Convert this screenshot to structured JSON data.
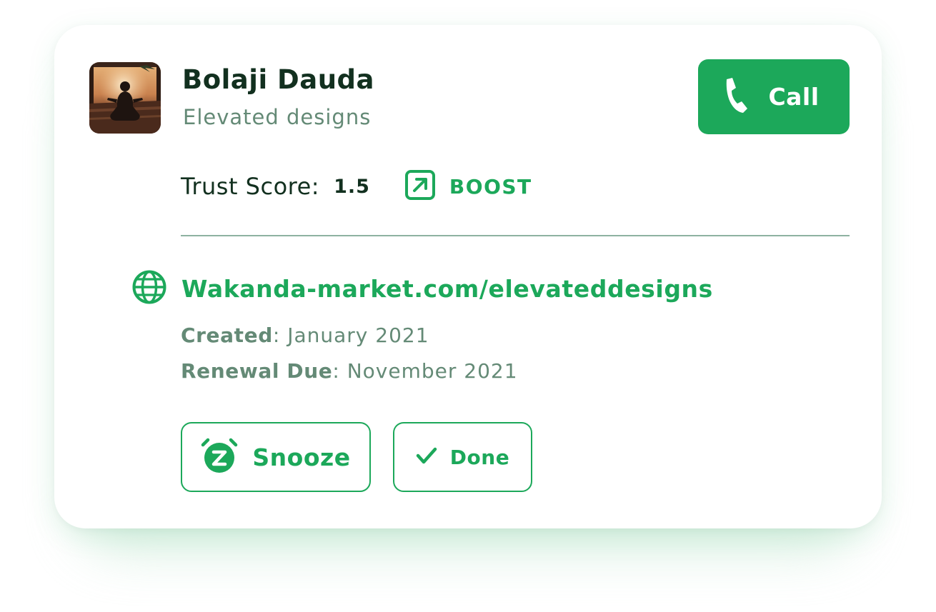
{
  "contact": {
    "name": "Bolaji Dauda",
    "company": "Elevated designs",
    "avatar_icon": "meditation-photo"
  },
  "call_button": {
    "label": "Call",
    "icon": "phone-icon"
  },
  "trust": {
    "label": "Trust Score:",
    "value": "1.5",
    "boost_label": "BOOST",
    "boost_icon": "arrow-up-right-square-icon"
  },
  "website": {
    "icon": "globe-icon",
    "url": "Wakanda-market.com/elevateddesigns"
  },
  "dates": {
    "created_label": "Created",
    "created_value": ": January 2021",
    "renewal_label": "Renewal Due",
    "renewal_value": ": November 2021"
  },
  "actions": {
    "snooze_label": "Snooze",
    "snooze_icon": "alarm-clock-z-icon",
    "done_label": "Done",
    "done_icon": "checkmark-icon"
  },
  "colors": {
    "brand_green": "#1ca85a",
    "heading_dark": "#12301f",
    "muted_text": "#648a76",
    "divider": "#8db2a1"
  }
}
